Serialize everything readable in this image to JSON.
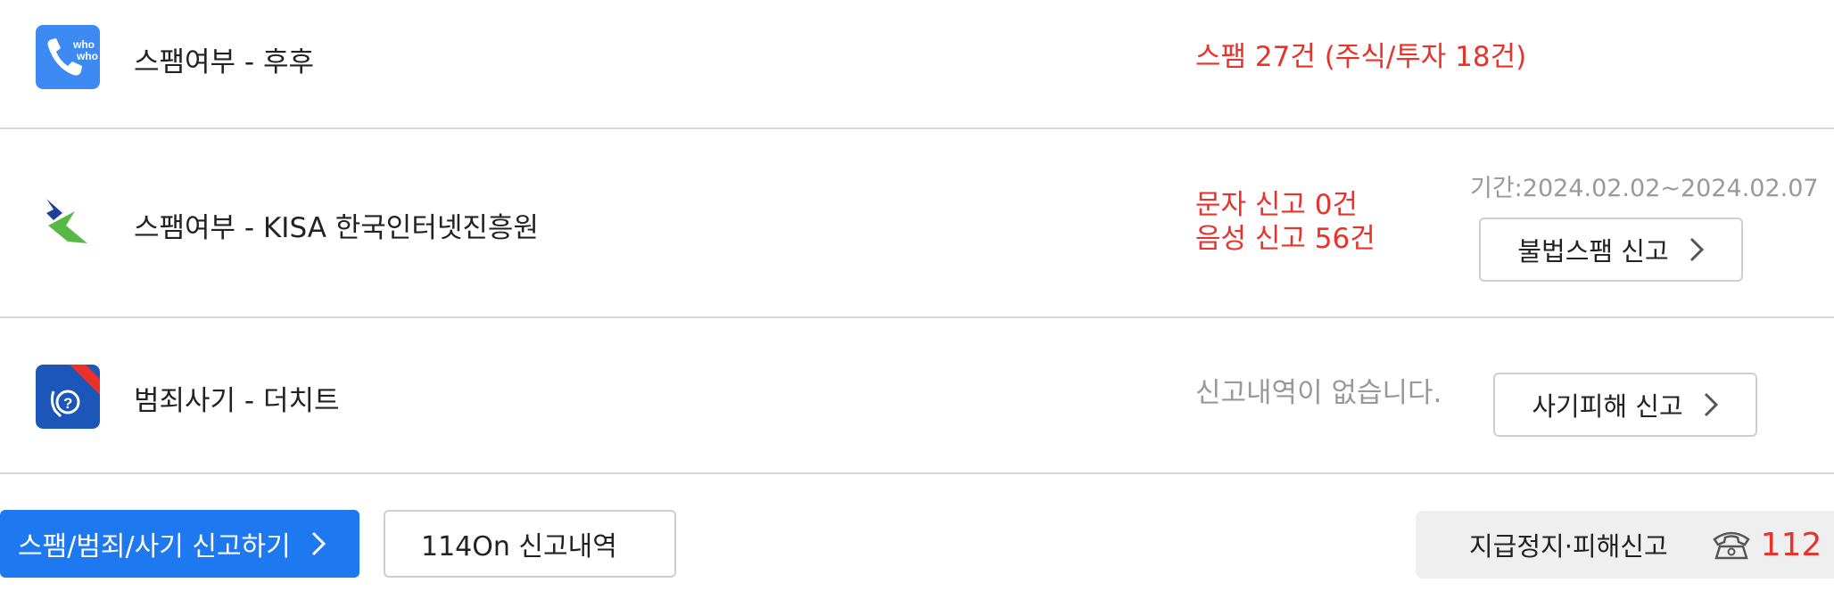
{
  "rows": [
    {
      "label": "스팸여부 - 후후",
      "result_lines": [
        "스팸 27건 (주식/투자 18건)"
      ],
      "icon": "whowho-app-icon",
      "icon_color": "#3d8bf2"
    },
    {
      "label": "스팸여부 - KISA 한국인터넷진흥원",
      "result_lines": [
        "문자 신고 0건",
        "음성 신고 56건"
      ],
      "period": "기간:2024.02.02~2024.02.07",
      "button": "불법스팸 신고",
      "icon": "kisa-logo-icon"
    },
    {
      "label": "범죄사기 - 더치트",
      "result_lines": [
        "신고내역이 없습니다."
      ],
      "button": "사기피해 신고",
      "icon": "thecheat-app-icon",
      "icon_color": "#1b56b8",
      "icon_ribbon": "사기 방지"
    }
  ],
  "footer": {
    "report_button": "스팸/범죄/사기 신고하기",
    "history_button": "114On 신고내역",
    "hotline_label": "지급정지·피해신고",
    "hotline_number": "112"
  },
  "colors": {
    "accent_blue": "#1e79f0",
    "alert_red": "#e8322a",
    "muted_gray": "#999999"
  }
}
